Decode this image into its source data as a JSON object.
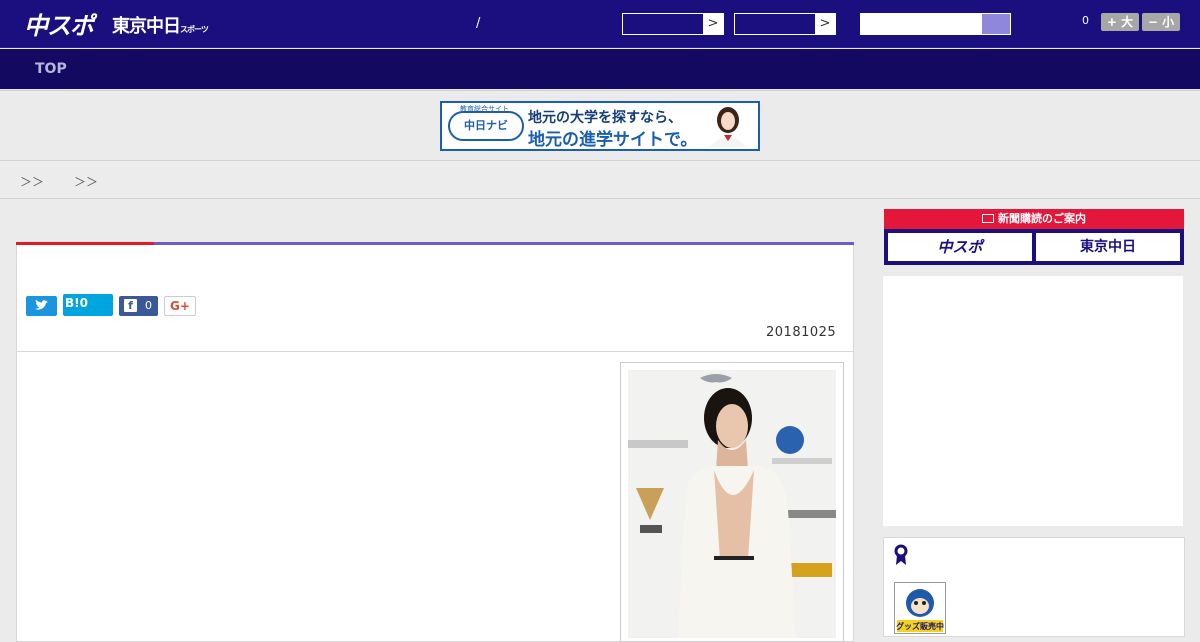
{
  "header": {
    "logo_main": "中スポ",
    "logo_sub": "東京中日",
    "logo_sub_small": "スポーツ",
    "separator": "/",
    "select1_arrow": ">",
    "select2_arrow": ">",
    "counter": "0",
    "font_larger": "+ 大",
    "font_smaller": "− 小"
  },
  "nav": {
    "top": "TOP"
  },
  "banner": {
    "badge": "中日ナビ",
    "small": "教育総合サイト",
    "line1": "地元の大学を探すなら、",
    "line2": "地元の進学サイトで。"
  },
  "breadcrumb": {
    "sep1": "＞＞",
    "sep2": "＞＞"
  },
  "article": {
    "share_twitter": "",
    "share_hatena": "B!0",
    "share_facebook": "0",
    "share_gplus": "G+",
    "date": "20181025"
  },
  "sidebar": {
    "subscribe_header": "新聞購読のご案内",
    "subscribe_chuspo": "中スポ",
    "subscribe_tokyo": "東京中日",
    "goods_label": "グッズ販売中"
  },
  "colors": {
    "brand": "#1b0f7f",
    "nav": "#140961",
    "accent_red": "#e31b23",
    "accent_purple": "#6b5fc7"
  }
}
